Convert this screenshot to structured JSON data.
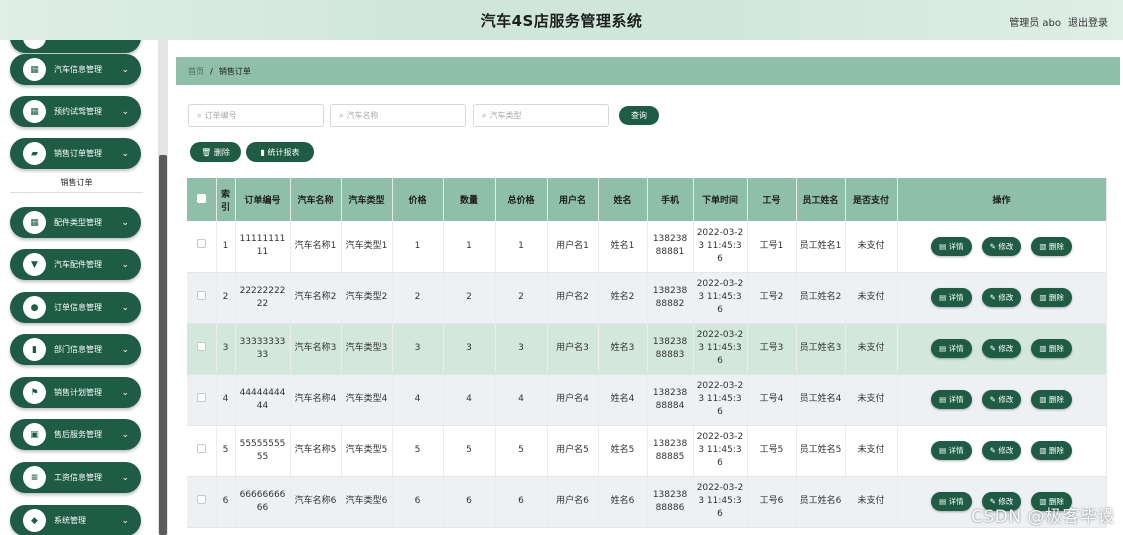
{
  "header": {
    "title": "汽车4S店服务管理系统",
    "user": "管理员 abo",
    "logout": "退出登录"
  },
  "sidebar": {
    "items": [
      {
        "label": "汽车信息管理",
        "icon": "grid-icon",
        "glyph": "▦"
      },
      {
        "label": "预约试驾管理",
        "icon": "grid-icon",
        "glyph": "▦"
      },
      {
        "label": "销售订单管理",
        "icon": "briefcase-icon",
        "glyph": "▰"
      },
      {
        "label": "配件类型管理",
        "icon": "grid-icon",
        "glyph": "▦"
      },
      {
        "label": "汽车配件管理",
        "icon": "trophy-icon",
        "glyph": "▼"
      },
      {
        "label": "订单信息管理",
        "icon": "user-icon",
        "glyph": "●"
      },
      {
        "label": "部门信息管理",
        "icon": "bar-chart-icon",
        "glyph": "▮"
      },
      {
        "label": "销售计划管理",
        "icon": "flag-icon",
        "glyph": "⚑"
      },
      {
        "label": "售后服务管理",
        "icon": "document-icon",
        "glyph": "▣"
      },
      {
        "label": "工资信息管理",
        "icon": "settings-icon",
        "glyph": "≡"
      },
      {
        "label": "系统管理",
        "icon": "shield-icon",
        "glyph": "◆"
      }
    ],
    "submenu": "销售订单"
  },
  "breadcrumb": {
    "home": "首页",
    "sep": "/",
    "current": "销售订单"
  },
  "search": {
    "order_placeholder": "订单编号",
    "car_name_placeholder": "汽车名称",
    "car_type_placeholder": "汽车类型",
    "query": "查询"
  },
  "actions": {
    "delete": "删除",
    "stats": "统计报表"
  },
  "table": {
    "headers": [
      "索引",
      "订单编号",
      "汽车名称",
      "汽车类型",
      "价格",
      "数量",
      "总价格",
      "用户名",
      "姓名",
      "手机",
      "下单时间",
      "工号",
      "员工姓名",
      "是否支付",
      "操作"
    ],
    "rows": [
      {
        "idx": "1",
        "order": "1111111111",
        "car_name": "汽车名称1",
        "car_type": "汽车类型1",
        "price": "1",
        "qty": "1",
        "total": "1",
        "username": "用户名1",
        "name": "姓名1",
        "phone": "13823888881",
        "time": "2022-03-23 11:45:36",
        "emp_no": "工号1",
        "emp_name": "员工姓名1",
        "paid": "未支付"
      },
      {
        "idx": "2",
        "order": "2222222222",
        "car_name": "汽车名称2",
        "car_type": "汽车类型2",
        "price": "2",
        "qty": "2",
        "total": "2",
        "username": "用户名2",
        "name": "姓名2",
        "phone": "13823888882",
        "time": "2022-03-23 11:45:36",
        "emp_no": "工号2",
        "emp_name": "员工姓名2",
        "paid": "未支付"
      },
      {
        "idx": "3",
        "order": "3333333333",
        "car_name": "汽车名称3",
        "car_type": "汽车类型3",
        "price": "3",
        "qty": "3",
        "total": "3",
        "username": "用户名3",
        "name": "姓名3",
        "phone": "13823888883",
        "time": "2022-03-23 11:45:36",
        "emp_no": "工号3",
        "emp_name": "员工姓名3",
        "paid": "未支付"
      },
      {
        "idx": "4",
        "order": "4444444444",
        "car_name": "汽车名称4",
        "car_type": "汽车类型4",
        "price": "4",
        "qty": "4",
        "total": "4",
        "username": "用户名4",
        "name": "姓名4",
        "phone": "13823888884",
        "time": "2022-03-23 11:45:36",
        "emp_no": "工号4",
        "emp_name": "员工姓名4",
        "paid": "未支付"
      },
      {
        "idx": "5",
        "order": "5555555555",
        "car_name": "汽车名称5",
        "car_type": "汽车类型5",
        "price": "5",
        "qty": "5",
        "total": "5",
        "username": "用户名5",
        "name": "姓名5",
        "phone": "13823888885",
        "time": "2022-03-23 11:45:36",
        "emp_no": "工号5",
        "emp_name": "员工姓名5",
        "paid": "未支付"
      },
      {
        "idx": "6",
        "order": "6666666666",
        "car_name": "汽车名称6",
        "car_type": "汽车类型6",
        "price": "6",
        "qty": "6",
        "total": "6",
        "username": "用户名6",
        "name": "姓名6",
        "phone": "13823888886",
        "time": "2022-03-23 11:45:36",
        "emp_no": "工号6",
        "emp_name": "员工姓名6",
        "paid": "未支付"
      }
    ],
    "op_detail": "详情",
    "op_edit": "修改",
    "op_delete": "删除"
  },
  "watermark": "CSDN @极客毕设",
  "colors": {
    "primary": "#1e5c45",
    "header_row": "#8fbfa8",
    "highlight_row": "#d3e7dd"
  }
}
